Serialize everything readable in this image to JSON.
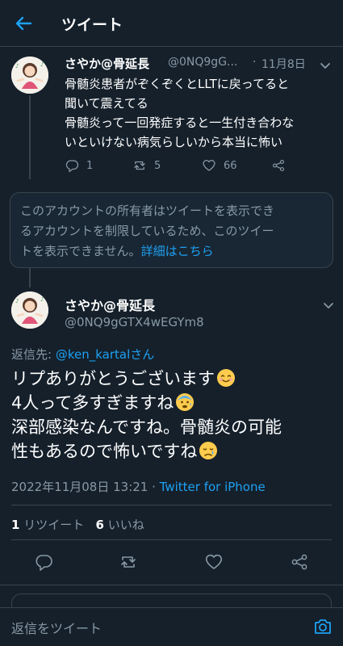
{
  "header": {
    "title": "ツイート"
  },
  "tweet1": {
    "name": "さやか@骨延長",
    "handle": "@0NQ9gG...",
    "dot": "·",
    "date": "11月8日",
    "lines": [
      "骨髄炎患者がぞくぞくとLLTに戻ってると",
      "聞いて震えてる",
      "骨髄炎って一回発症すると一生付き合わな",
      "いといけない病気らしいから本当に怖い"
    ],
    "replies": "1",
    "retweets": "5",
    "likes": "66"
  },
  "unavailable": {
    "line1": "このアカウントの所有者はツイートを表示でき",
    "line2": "るアカウントを制限しているため、このツイー",
    "line3_prefix": "トを表示できません。",
    "link": "詳細はこちら"
  },
  "tweet2": {
    "name": "さやか@骨延長",
    "handle": "@0NQ9gGTX4wEGYm8",
    "reply_prefix": "返信先: ",
    "reply_to": "@ken_kartal",
    "reply_suffix": "さん",
    "line1": "リプありがとうございます",
    "line2": "4人って多すぎますね",
    "line3": "深部感染なんですね。骨髄炎の可能",
    "line4": "性もあるので怖いですね",
    "timestamp": "2022年11月08日 13:21",
    "sep": " · ",
    "source": "Twitter for iPhone",
    "retweet_count": "1",
    "retweet_label": " リツイート",
    "like_count": "6",
    "like_label": " いいね"
  },
  "composer": {
    "placeholder": "返信をツイート"
  },
  "colors": {
    "background": "#15202b",
    "accent": "#1da1f2",
    "muted": "#8899a6",
    "border": "#38444d"
  }
}
